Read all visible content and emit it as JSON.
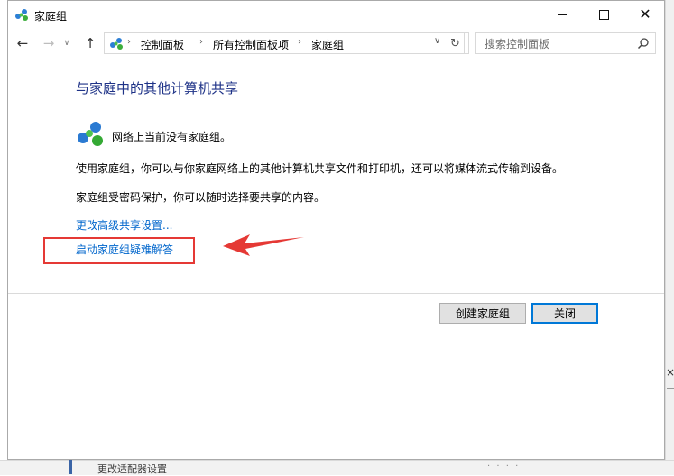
{
  "window": {
    "title": "家庭组",
    "controls": {
      "minimize": "minimize-icon",
      "maximize": "maximize-icon",
      "close": "close-icon"
    }
  },
  "nav": {
    "back_icon": "arrow-left-icon",
    "forward_icon": "arrow-right-icon",
    "recent_icon": "chevron-down-icon",
    "up_icon": "arrow-up-icon",
    "breadcrumbs": [
      "控制面板",
      "所有控制面板项",
      "家庭组"
    ],
    "refresh_icon": "refresh-icon",
    "search_placeholder": "搜索控制面板"
  },
  "content": {
    "heading": "与家庭中的其他计算机共享",
    "status": "网络上当前没有家庭组。",
    "paragraph1": "使用家庭组，你可以与你家庭网络上的其他计算机共享文件和打印机，还可以将媒体流式传输到设备。",
    "paragraph2": "家庭组受密码保护，你可以随时选择要共享的内容。",
    "links": {
      "advanced_sharing": "更改高级共享设置...",
      "troubleshooter": "启动家庭组疑难解答"
    }
  },
  "annotation": {
    "box_color": "#e53935",
    "arrow_color": "#e53935"
  },
  "buttons": {
    "create": "创建家庭组",
    "close": "关闭"
  },
  "background_window": {
    "bottom_text": "更改适配器设置",
    "right_x": "×"
  },
  "colors": {
    "heading": "#1e3287",
    "link": "#0066cc",
    "focus_border": "#0078d7"
  }
}
